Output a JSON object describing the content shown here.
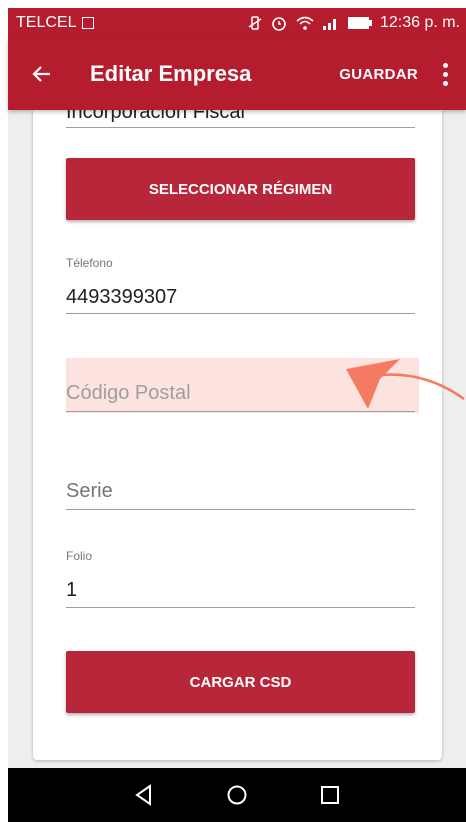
{
  "status_bar": {
    "carrier": "TELCEL",
    "time": "12:36 p. m."
  },
  "app_bar": {
    "title": "Editar Empresa",
    "save_label": "GUARDAR"
  },
  "form": {
    "regimen_value": "Incorporación Fiscal",
    "select_regimen_label": "SELECCIONAR RÉGIMEN",
    "telefono_label": "Télefono",
    "telefono_value": "4493399307",
    "codigo_postal_placeholder": "Código Postal",
    "serie_placeholder": "Serie",
    "folio_label": "Folio",
    "folio_value": "1",
    "cargar_csd_label": "CARGAR CSD"
  },
  "colors": {
    "primary": "#b51d2e",
    "highlight": "#fde3df",
    "annotation_arrow": "#f47a62"
  },
  "icons": [
    "back-arrow-icon",
    "more-vert-icon",
    "nav-back-icon",
    "nav-home-icon",
    "nav-recents-icon"
  ]
}
